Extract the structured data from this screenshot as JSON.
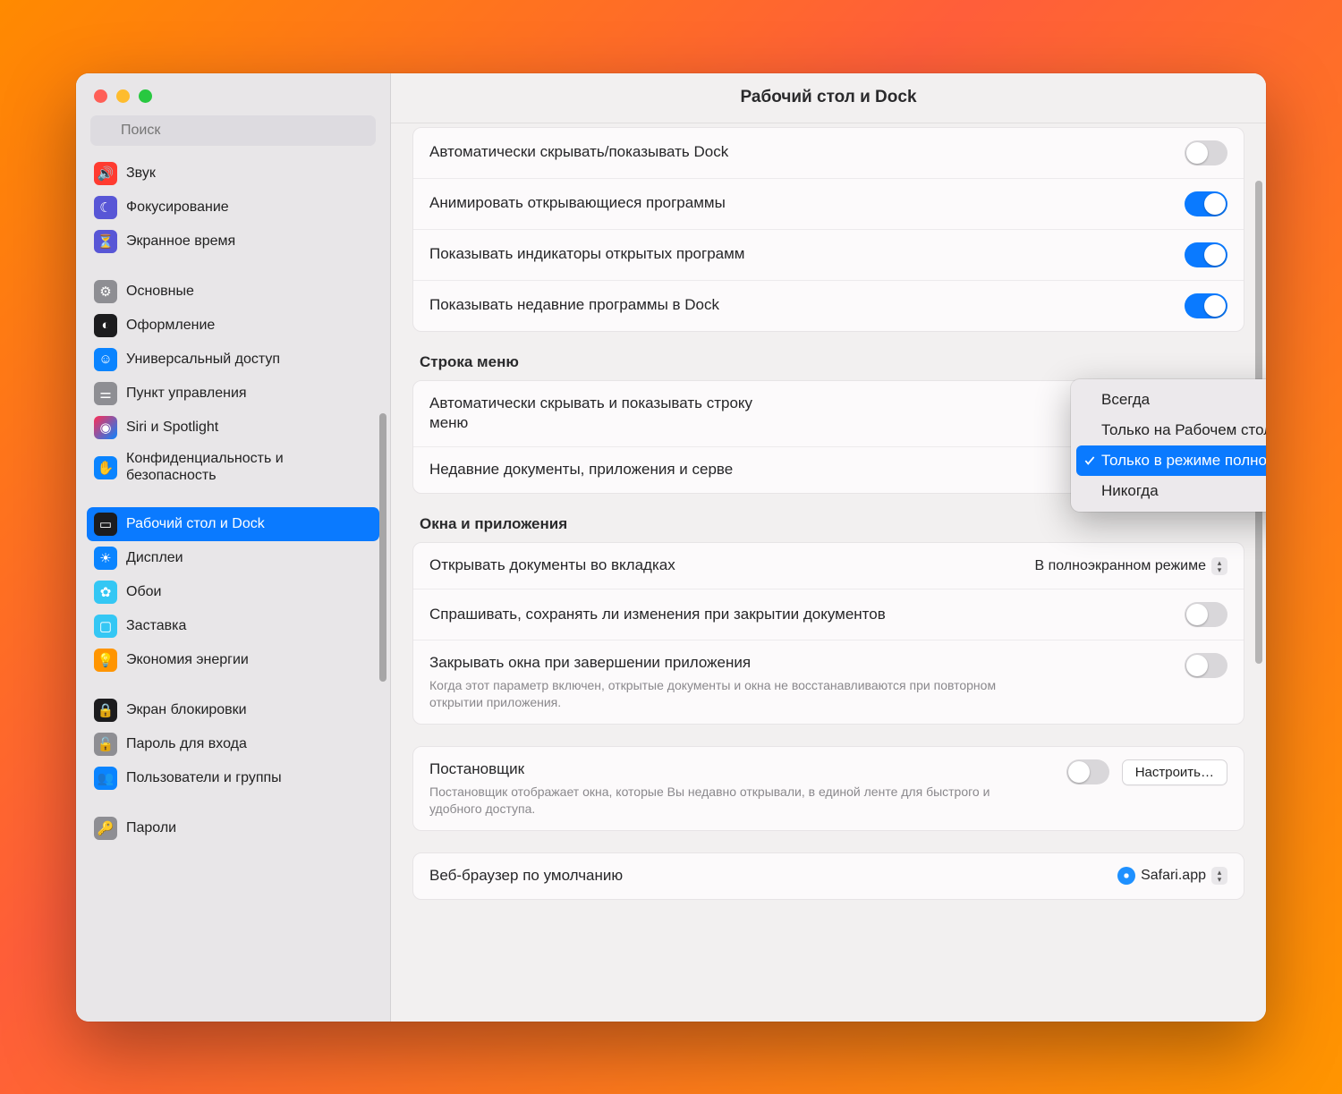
{
  "window": {
    "title": "Рабочий стол и Dock"
  },
  "search": {
    "placeholder": "Поиск"
  },
  "sidebar": {
    "items": [
      {
        "label": "Звук",
        "icon": "sound-icon",
        "bg": "#ff3b30"
      },
      {
        "label": "Фокусирование",
        "icon": "moon-icon",
        "bg": "#5856d6"
      },
      {
        "label": "Экранное время",
        "icon": "hourglass-icon",
        "bg": "#5856d6"
      }
    ],
    "group2": [
      {
        "label": "Основные",
        "icon": "gear-icon",
        "bg": "#8e8e93"
      },
      {
        "label": "Оформление",
        "icon": "contrast-icon",
        "bg": "#1c1c1e"
      },
      {
        "label": "Универсальный доступ",
        "icon": "accessibility-icon",
        "bg": "#0a84ff"
      },
      {
        "label": "Пункт управления",
        "icon": "sliders-icon",
        "bg": "#8e8e93"
      },
      {
        "label": "Siri и Spotlight",
        "icon": "siri-icon",
        "bg": "#1c1c1e"
      },
      {
        "label": "Конфиденциальность и безопасность",
        "icon": "hand-icon",
        "bg": "#0a84ff"
      }
    ],
    "group3": [
      {
        "label": "Рабочий стол и Dock",
        "icon": "dock-icon",
        "bg": "#1c1c1e",
        "selected": true
      },
      {
        "label": "Дисплеи",
        "icon": "brightness-icon",
        "bg": "#0a84ff"
      },
      {
        "label": "Обои",
        "icon": "flower-icon",
        "bg": "#34c7f4"
      },
      {
        "label": "Заставка",
        "icon": "screensaver-icon",
        "bg": "#34c7f4"
      },
      {
        "label": "Экономия энергии",
        "icon": "bulb-icon",
        "bg": "#ff9500"
      }
    ],
    "group4": [
      {
        "label": "Экран блокировки",
        "icon": "lock-icon",
        "bg": "#1c1c1e"
      },
      {
        "label": "Пароль для входа",
        "icon": "padlock-icon",
        "bg": "#8e8e93"
      },
      {
        "label": "Пользователи и группы",
        "icon": "users-icon",
        "bg": "#0a84ff"
      }
    ],
    "group5": [
      {
        "label": "Пароли",
        "icon": "key-icon",
        "bg": "#8e8e93"
      }
    ]
  },
  "dock": {
    "rows": [
      {
        "label": "Автоматически скрывать/показывать Dock",
        "on": false
      },
      {
        "label": "Анимировать открывающиеся программы",
        "on": true
      },
      {
        "label": "Показывать индикаторы открытых программ",
        "on": true
      },
      {
        "label": "Показывать недавние программы в Dock",
        "on": true
      }
    ]
  },
  "menubar": {
    "title": "Строка меню",
    "rows": [
      {
        "label": "Автоматически скрывать и показывать строку меню"
      },
      {
        "label": "Недавние документы, приложения и серве"
      }
    ]
  },
  "dropdown": {
    "items": [
      {
        "label": "Всегда"
      },
      {
        "label": "Только на Рабочем столе"
      },
      {
        "label": "Только в режиме полного экрана",
        "selected": true
      },
      {
        "label": "Никогда"
      }
    ]
  },
  "windows": {
    "title": "Окна и приложения",
    "tabs_label": "Открывать документы во вкладках",
    "tabs_value": "В полноэкранном режиме",
    "ask_save": "Спрашивать, сохранять ли изменения при закрытии документов",
    "close_quit": "Закрывать окна при завершении приложения",
    "close_quit_sub": "Когда этот параметр включен, открытые документы и окна не восстанавливаются при повторном открытии приложения."
  },
  "stage": {
    "title": "Постановщик",
    "sub": "Постановщик отображает окна, которые Вы недавно открывали, в единой ленте для быстрого и удобного доступа.",
    "button": "Настроить…"
  },
  "browser": {
    "label": "Веб-браузер по умолчанию",
    "value": "Safari.app"
  }
}
